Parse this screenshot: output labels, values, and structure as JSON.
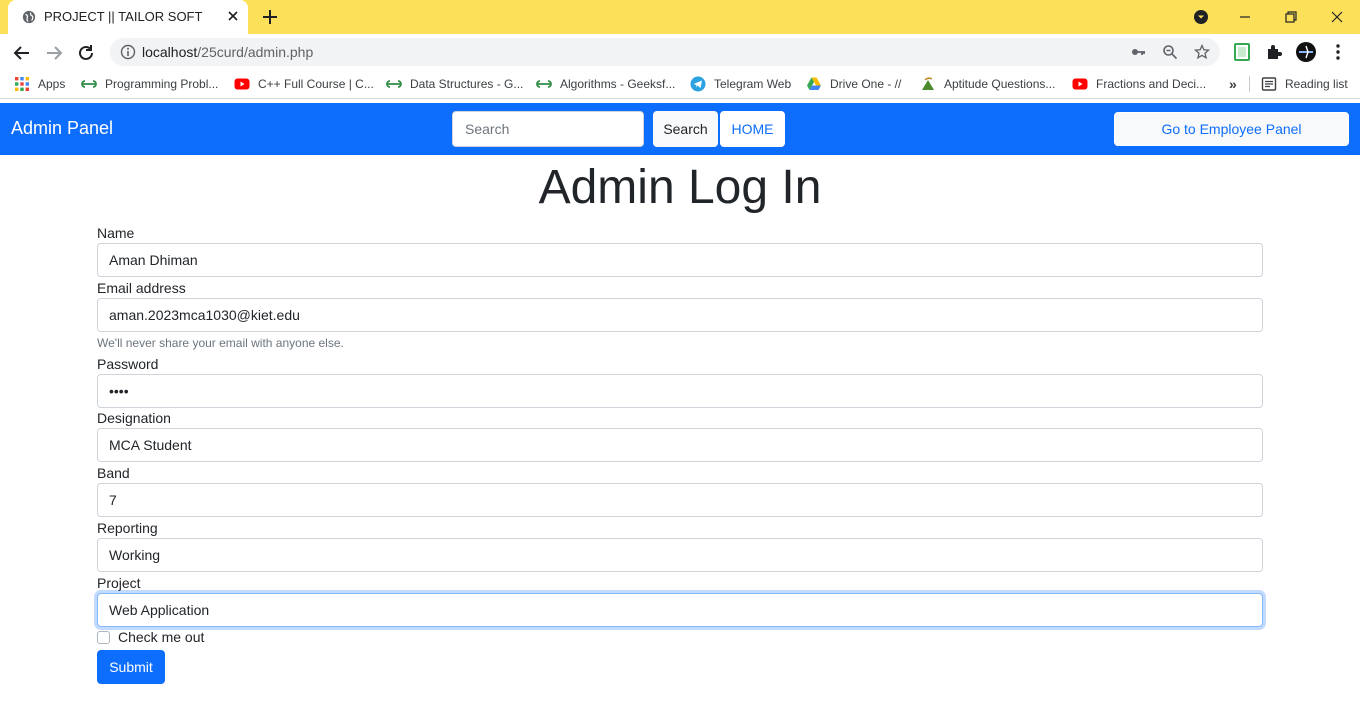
{
  "browser": {
    "tab": {
      "title": "PROJECT || TAILOR SOFT"
    },
    "address_bar": {
      "host": "localhost",
      "path": "/25curd/admin.php"
    },
    "bookmarks": {
      "apps": "Apps",
      "items": [
        "Programming Probl...",
        "C++ Full Course | C...",
        "Data Structures - G...",
        "Algorithms - Geeksf...",
        "Telegram Web",
        "Drive One - //",
        "Aptitude Questions...",
        "Fractions and Deci..."
      ],
      "overflow": "»",
      "reading_list": "Reading list"
    },
    "theme_color": "#fde05a"
  },
  "navbar": {
    "brand": "Admin Panel",
    "search_placeholder": "Search",
    "search_button": "Search",
    "home_button": "HOME",
    "employee_button": "Go to Employee Panel",
    "color": "#0d6efd"
  },
  "form": {
    "title": "Admin Log In",
    "name_label": "Name",
    "name_value": "Aman Dhiman",
    "email_label": "Email address",
    "email_value": "aman.2023mca1030@kiet.edu",
    "email_help": "We'll never share your email with anyone else.",
    "password_label": "Password",
    "password_value": "1234",
    "designation_label": "Designation",
    "designation_value": "MCA Student",
    "band_label": "Band",
    "band_value": "7",
    "reporting_label": "Reporting",
    "reporting_value": "Working",
    "project_label": "Project",
    "project_value": "Web Application",
    "checkbox_label": "Check me out",
    "submit_label": "Submit"
  }
}
